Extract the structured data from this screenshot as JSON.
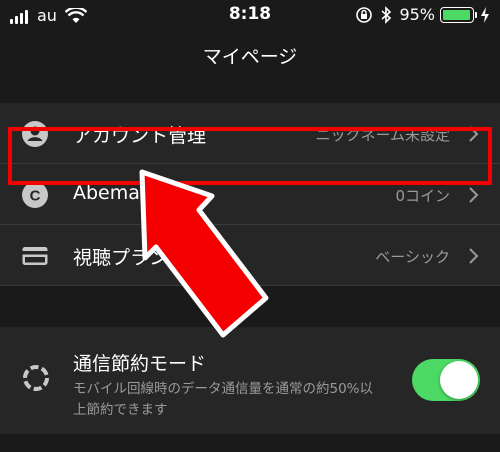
{
  "status_bar": {
    "carrier": "au",
    "time": "8:18",
    "battery_percent": "95%",
    "battery_level": 0.95
  },
  "nav": {
    "title": "マイページ"
  },
  "account_rows": [
    {
      "icon": "user-icon",
      "label": "アカウント管理",
      "value": "ニックネーム未設定"
    },
    {
      "icon": "coin-icon",
      "label": "Abema",
      "value": "0コイン"
    },
    {
      "icon": "card-icon",
      "label": "視聴プラン",
      "value": "ベーシック"
    }
  ],
  "data_saving": {
    "title": "通信節約モード",
    "description": "モバイル回線時のデータ通信量を通常の約50%以上節約できます",
    "enabled": true
  },
  "colors": {
    "accent": "#4cd964",
    "highlight": "#f40000",
    "background": "#1a1a1a"
  }
}
